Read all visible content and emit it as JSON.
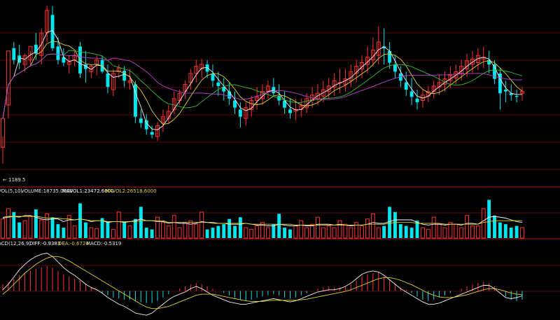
{
  "price_panel": {
    "low_marker_label": "1189.5",
    "arrow_glyph": "←"
  },
  "volume_panel": {
    "header_prefix": "VOL(5,10)",
    "volume_label": "VOLUME:18735.0000",
    "mavol1_label": "MAVOL1:23472.6000",
    "mavol2_label": "MAVOL2:26518.6000"
  },
  "macd_panel": {
    "header_prefix": "ACD(12,26,9)",
    "diff_label": "DIFF:-0.9383",
    "dea_label": "DEA:-0.6724",
    "macd_label": "MACD:-0.5319"
  },
  "colors": {
    "up": "#ff3030",
    "down": "#00e5ee",
    "panel_border": "#b01818",
    "grid": "#5a0a0a",
    "ma_white": "#f2f2f2",
    "ma_yellow": "#e0d230",
    "ma_purple": "#c040d0",
    "ma_green": "#30c030",
    "header_text": "#e8e8e8",
    "mavol1_text": "#ffffff",
    "mavol2_text": "#e0d230"
  },
  "chart_data": [
    {
      "type": "candlestick",
      "title": "",
      "min_label": "1189.5",
      "ylim": [
        1185,
        1370
      ],
      "series": [
        {
          "name": "open",
          "values": [
            1208,
            1255,
            1318,
            1310,
            1300,
            1305,
            1322,
            1310,
            1335,
            1355,
            1320,
            1308,
            1300,
            1305,
            1320,
            1300,
            1292,
            1300,
            1305,
            1290,
            1272,
            1292,
            1293,
            1280,
            1278,
            1240,
            1238,
            1225,
            1220,
            1235,
            1240,
            1250,
            1260,
            1270,
            1280,
            1290,
            1295,
            1300,
            1290,
            1280,
            1275,
            1270,
            1260,
            1250,
            1240,
            1250,
            1260,
            1262,
            1270,
            1275,
            1265,
            1260,
            1250,
            1248,
            1250,
            1252,
            1260,
            1262,
            1265,
            1270,
            1275,
            1280,
            1278,
            1282,
            1290,
            1295,
            1300,
            1305,
            1310,
            1320,
            1315,
            1300,
            1290,
            1280,
            1270,
            1262,
            1260,
            1265,
            1270,
            1275,
            1278,
            1282,
            1285,
            1290,
            1295,
            1300,
            1302,
            1306,
            1305,
            1300,
            1290,
            1272,
            1268,
            1265,
            1268
          ]
        },
        {
          "name": "high",
          "values": [
            1220,
            1270,
            1325,
            1322,
            1312,
            1315,
            1335,
            1340,
            1365,
            1365,
            1330,
            1318,
            1310,
            1315,
            1325,
            1315,
            1300,
            1310,
            1310,
            1300,
            1295,
            1300,
            1298,
            1295,
            1282,
            1250,
            1245,
            1232,
            1236,
            1250,
            1255,
            1270,
            1272,
            1282,
            1295,
            1305,
            1306,
            1305,
            1300,
            1292,
            1285,
            1280,
            1270,
            1258,
            1258,
            1265,
            1275,
            1278,
            1282,
            1285,
            1278,
            1270,
            1262,
            1262,
            1262,
            1268,
            1275,
            1278,
            1282,
            1285,
            1290,
            1295,
            1295,
            1300,
            1305,
            1310,
            1320,
            1330,
            1342,
            1340,
            1325,
            1310,
            1298,
            1292,
            1285,
            1272,
            1272,
            1276,
            1282,
            1288,
            1292,
            1298,
            1300,
            1305,
            1312,
            1315,
            1318,
            1320,
            1315,
            1305,
            1296,
            1282,
            1278,
            1272,
            1275
          ]
        },
        {
          "name": "low",
          "values": [
            1190,
            1240,
            1300,
            1295,
            1292,
            1298,
            1305,
            1300,
            1325,
            1315,
            1300,
            1298,
            1290,
            1298,
            1285,
            1280,
            1285,
            1288,
            1290,
            1268,
            1265,
            1285,
            1275,
            1272,
            1235,
            1230,
            1222,
            1218,
            1215,
            1225,
            1235,
            1245,
            1255,
            1262,
            1272,
            1280,
            1285,
            1285,
            1275,
            1265,
            1260,
            1255,
            1245,
            1230,
            1232,
            1242,
            1250,
            1255,
            1262,
            1265,
            1255,
            1245,
            1240,
            1238,
            1242,
            1246,
            1252,
            1255,
            1258,
            1262,
            1265,
            1268,
            1270,
            1275,
            1280,
            1285,
            1290,
            1298,
            1300,
            1300,
            1295,
            1285,
            1275,
            1265,
            1255,
            1250,
            1252,
            1258,
            1262,
            1266,
            1270,
            1274,
            1278,
            1282,
            1286,
            1290,
            1294,
            1296,
            1290,
            1278,
            1250,
            1258,
            1260,
            1258,
            1260
          ]
        },
        {
          "name": "close",
          "values": [
            1240,
            1315,
            1305,
            1302,
            1310,
            1320,
            1312,
            1335,
            1360,
            1318,
            1305,
            1302,
            1303,
            1310,
            1290,
            1295,
            1298,
            1305,
            1292,
            1275,
            1290,
            1296,
            1282,
            1282,
            1242,
            1235,
            1228,
            1222,
            1232,
            1242,
            1248,
            1262,
            1268,
            1278,
            1290,
            1298,
            1300,
            1292,
            1282,
            1276,
            1270,
            1262,
            1252,
            1242,
            1252,
            1260,
            1264,
            1270,
            1276,
            1268,
            1260,
            1252,
            1246,
            1250,
            1254,
            1262,
            1266,
            1268,
            1272,
            1276,
            1282,
            1280,
            1284,
            1292,
            1298,
            1302,
            1308,
            1316,
            1325,
            1318,
            1302,
            1292,
            1282,
            1272,
            1264,
            1258,
            1266,
            1270,
            1276,
            1280,
            1284,
            1288,
            1292,
            1298,
            1304,
            1306,
            1310,
            1308,
            1300,
            1284,
            1268,
            1270,
            1266,
            1264,
            1270
          ]
        }
      ],
      "moving_averages": [
        "white",
        "yellow",
        "purple",
        "green"
      ]
    },
    {
      "type": "bar",
      "title": "VOL(5,10)",
      "values": [
        22,
        34,
        30,
        18,
        20,
        25,
        33,
        21,
        28,
        24,
        16,
        12,
        26,
        14,
        40,
        18,
        12,
        11,
        23,
        19,
        10,
        30,
        18,
        14,
        22,
        36,
        12,
        10,
        24,
        18,
        14,
        26,
        12,
        18,
        20,
        16,
        30,
        10,
        12,
        14,
        16,
        22,
        14,
        24,
        12,
        10,
        14,
        18,
        12,
        16,
        28,
        12,
        10,
        14,
        20,
        12,
        16,
        24,
        12,
        14,
        12,
        20,
        16,
        12,
        18,
        14,
        22,
        28,
        12,
        14,
        36,
        30,
        16,
        14,
        12,
        20,
        12,
        10,
        24,
        16,
        12,
        18,
        16,
        12,
        26,
        14,
        14,
        34,
        44,
        26,
        18,
        16,
        12,
        14,
        12
      ],
      "ylim": [
        0,
        50
      ],
      "series": [
        {
          "name": "MAVOL1",
          "values": [
            23,
            24,
            25,
            24,
            26,
            26,
            24,
            22,
            21,
            22,
            22,
            19,
            21,
            21,
            22,
            21,
            19,
            20,
            20,
            18,
            19,
            19,
            18,
            19,
            20,
            22,
            20,
            20,
            19,
            19,
            17,
            18,
            17,
            17,
            16,
            17,
            19,
            18,
            18,
            17,
            17,
            16,
            16,
            16,
            17,
            16,
            15,
            15,
            14,
            14,
            16,
            15,
            14,
            14,
            15,
            14,
            14,
            16,
            16,
            16,
            15,
            16,
            15,
            14,
            15,
            15,
            16,
            18,
            17,
            17,
            19,
            21,
            21,
            21,
            21,
            18,
            16,
            15,
            16,
            16,
            15,
            16,
            16,
            15,
            17,
            17,
            16,
            20,
            24,
            25,
            24,
            23,
            21,
            19,
            18
          ]
        },
        {
          "name": "MAVOL2",
          "values": [
            24,
            25,
            25,
            25,
            25,
            25,
            25,
            24,
            23,
            23,
            23,
            22,
            22,
            21,
            22,
            21,
            20,
            20,
            20,
            19,
            19,
            19,
            19,
            19,
            19,
            20,
            20,
            20,
            20,
            20,
            18,
            18,
            18,
            18,
            18,
            18,
            18,
            18,
            17,
            17,
            17,
            17,
            17,
            17,
            17,
            16,
            16,
            16,
            16,
            16,
            16,
            16,
            16,
            15,
            15,
            15,
            15,
            15,
            15,
            15,
            15,
            15,
            15,
            15,
            15,
            15,
            16,
            16,
            16,
            16,
            17,
            18,
            18,
            18,
            18,
            17,
            17,
            17,
            17,
            17,
            16,
            16,
            16,
            16,
            16,
            16,
            16,
            18,
            19,
            20,
            20,
            20,
            20,
            20,
            20
          ]
        }
      ]
    },
    {
      "type": "bar",
      "title": "ACD(12,26,9)",
      "values": [
        1.2,
        1.6,
        2.2,
        2.8,
        3.2,
        3.6,
        4.0,
        4.2,
        4.5,
        4.2,
        3.6,
        3.0,
        2.6,
        2.2,
        1.8,
        1.2,
        0.6,
        0.2,
        -0.4,
        -0.8,
        -1.2,
        -1.4,
        -1.6,
        -1.6,
        -1.8,
        -2.0,
        -2.2,
        -2.2,
        -1.8,
        -1.2,
        -0.6,
        0.0,
        0.4,
        0.8,
        1.2,
        1.4,
        1.2,
        0.8,
        0.4,
        0.0,
        -0.4,
        -0.8,
        -1.2,
        -1.6,
        -1.8,
        -1.6,
        -1.2,
        -1.0,
        -0.8,
        -0.6,
        -0.8,
        -1.2,
        -1.4,
        -1.2,
        -0.8,
        -0.4,
        0.0,
        0.4,
        0.6,
        0.8,
        0.6,
        0.6,
        0.8,
        1.2,
        1.8,
        2.6,
        3.0,
        3.2,
        3.4,
        2.8,
        2.0,
        1.2,
        0.6,
        0.2,
        -0.4,
        -1.0,
        -1.6,
        -1.8,
        -1.6,
        -1.2,
        -0.8,
        -0.4,
        0.0,
        0.4,
        0.8,
        1.2,
        1.4,
        1.6,
        1.4,
        0.8,
        0.0,
        -1.0,
        -1.6,
        -1.8,
        -1.6
      ],
      "ylim": [
        -5,
        8
      ],
      "series": [
        {
          "name": "DIFF",
          "values": [
            0.2,
            1.2,
            2.5,
            3.8,
            4.8,
            5.6,
            6.2,
            6.6,
            6.8,
            6.2,
            5.2,
            4.2,
            3.4,
            2.8,
            2.0,
            1.2,
            0.6,
            0.2,
            -0.4,
            -1.2,
            -1.8,
            -2.4,
            -2.8,
            -3.4,
            -4.0,
            -4.2,
            -4.4,
            -4.0,
            -3.2,
            -2.4,
            -1.6,
            -1.0,
            -0.6,
            -0.2,
            0.4,
            0.8,
            0.4,
            -0.2,
            -0.8,
            -1.2,
            -1.6,
            -2.0,
            -2.2,
            -2.4,
            -2.4,
            -2.2,
            -2.0,
            -1.8,
            -1.6,
            -1.4,
            -1.6,
            -1.8,
            -2.0,
            -1.8,
            -1.4,
            -1.0,
            -0.6,
            -0.2,
            0.0,
            0.2,
            0.2,
            0.4,
            0.8,
            1.4,
            2.2,
            3.0,
            3.4,
            3.6,
            3.4,
            2.8,
            2.0,
            1.2,
            0.4,
            -0.2,
            -0.8,
            -1.4,
            -2.0,
            -2.4,
            -2.4,
            -2.2,
            -1.8,
            -1.4,
            -1.0,
            -0.6,
            -0.2,
            0.2,
            0.6,
            1.0,
            1.0,
            0.4,
            -0.4,
            -1.2,
            -1.4,
            -1.2,
            -0.9
          ]
        },
        {
          "name": "DEA",
          "values": [
            -0.6,
            0.2,
            1.2,
            2.2,
            3.2,
            4.0,
            4.8,
            5.4,
            5.9,
            6.2,
            6.2,
            5.9,
            5.4,
            4.8,
            4.2,
            3.6,
            3.0,
            2.4,
            1.8,
            1.2,
            0.6,
            0.0,
            -0.6,
            -1.2,
            -1.8,
            -2.4,
            -2.9,
            -3.2,
            -3.2,
            -3.0,
            -2.8,
            -2.4,
            -2.0,
            -1.6,
            -1.2,
            -0.8,
            -0.6,
            -0.6,
            -0.6,
            -0.8,
            -1.0,
            -1.2,
            -1.4,
            -1.6,
            -1.8,
            -1.9,
            -1.9,
            -1.9,
            -1.8,
            -1.7,
            -1.7,
            -1.7,
            -1.7,
            -1.7,
            -1.6,
            -1.5,
            -1.3,
            -1.1,
            -0.9,
            -0.7,
            -0.5,
            -0.3,
            -0.1,
            0.2,
            0.6,
            1.0,
            1.4,
            1.8,
            2.2,
            2.4,
            2.4,
            2.2,
            1.9,
            1.5,
            1.1,
            0.6,
            0.1,
            -0.4,
            -0.8,
            -1.1,
            -1.2,
            -1.2,
            -1.1,
            -0.9,
            -0.7,
            -0.4,
            -0.1,
            0.2,
            0.4,
            0.4,
            0.2,
            -0.1,
            -0.4,
            -0.6,
            -0.7
          ]
        }
      ]
    }
  ]
}
